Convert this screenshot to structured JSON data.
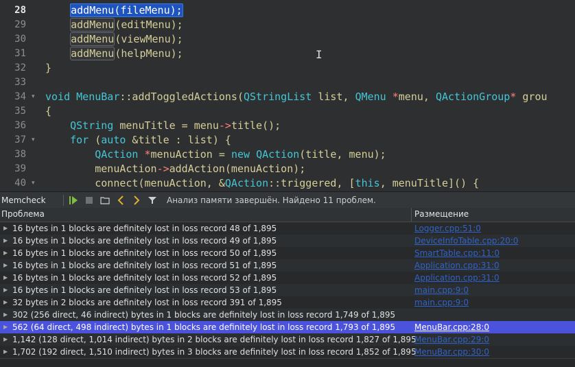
{
  "editor": {
    "lines": [
      {
        "num": "28",
        "current": true,
        "fold": "",
        "tokens": [
          [
            "",
            "    "
          ],
          [
            "sel",
            "addMenu(fileMenu);"
          ]
        ]
      },
      {
        "num": "29",
        "fold": "",
        "tokens": [
          [
            "",
            "    "
          ],
          [
            "hl",
            "addMenu"
          ],
          [
            "",
            "(editMenu);"
          ]
        ]
      },
      {
        "num": "30",
        "fold": "",
        "tokens": [
          [
            "",
            "    "
          ],
          [
            "hl",
            "addMenu"
          ],
          [
            "",
            "(viewMenu);"
          ]
        ]
      },
      {
        "num": "31",
        "fold": "",
        "tokens": [
          [
            "",
            "    "
          ],
          [
            "hl",
            "addMenu"
          ],
          [
            "",
            "(helpMenu);"
          ]
        ]
      },
      {
        "num": "32",
        "fold": "",
        "tokens": [
          [
            "",
            "}"
          ]
        ]
      },
      {
        "num": "33",
        "fold": "",
        "tokens": []
      },
      {
        "num": "34",
        "fold": "▾",
        "tokens": [
          [
            "kw",
            "void "
          ],
          [
            "ty",
            "MenuBar"
          ],
          [
            "",
            "::addToggledActions("
          ],
          [
            "ty",
            "QStringList"
          ],
          [
            "",
            " list, "
          ],
          [
            "ty",
            "QMenu"
          ],
          [
            "ar",
            " *"
          ],
          [
            "",
            "menu, "
          ],
          [
            "ty",
            "QActionGroup"
          ],
          [
            "ar",
            "*"
          ],
          [
            "",
            " grou"
          ]
        ]
      },
      {
        "num": "35",
        "fold": "",
        "tokens": [
          [
            "",
            "{"
          ]
        ]
      },
      {
        "num": "36",
        "fold": "",
        "tokens": [
          [
            "",
            "    "
          ],
          [
            "ty",
            "QString"
          ],
          [
            "",
            " menuTitle = menu"
          ],
          [
            "ar",
            "->"
          ],
          [
            "",
            "title();"
          ]
        ]
      },
      {
        "num": "37",
        "fold": "▾",
        "tokens": [
          [
            "",
            "    "
          ],
          [
            "kw",
            "for"
          ],
          [
            "",
            " ("
          ],
          [
            "kw",
            "auto"
          ],
          [
            "",
            " &title : list) {"
          ]
        ]
      },
      {
        "num": "38",
        "fold": "",
        "tokens": [
          [
            "",
            "        "
          ],
          [
            "ty",
            "QAction"
          ],
          [
            "ar",
            " *"
          ],
          [
            "",
            "menuAction = "
          ],
          [
            "kw",
            "new "
          ],
          [
            "ty",
            "QAction"
          ],
          [
            "",
            "(title, menu);"
          ]
        ]
      },
      {
        "num": "39",
        "fold": "",
        "tokens": [
          [
            "",
            "        menuAction"
          ],
          [
            "ar",
            "->"
          ],
          [
            "",
            "addAction(menuAction);"
          ]
        ]
      },
      {
        "num": "40",
        "fold": "▾",
        "tokens": [
          [
            "",
            "        connect(menuAction, &"
          ],
          [
            "ty",
            "QAction"
          ],
          [
            "",
            "::triggered, ["
          ],
          [
            "kw",
            "this"
          ],
          [
            "",
            ", menuTitle]() {"
          ]
        ]
      }
    ]
  },
  "toolbar": {
    "title": "Memcheck",
    "status": "Анализ памяти завершён. Найдено 11 проблем.",
    "icons": [
      "run-analysis-icon",
      "stop-icon",
      "open-icon",
      "previous-icon",
      "next-icon",
      "filter-icon"
    ]
  },
  "table": {
    "headers": {
      "problem": "Проблема",
      "location": "Размещение"
    },
    "rows": [
      {
        "desc": "16 bytes in 1 blocks are definitely lost in loss record 48 of 1,895",
        "loc": "Logger.cpp:51:0"
      },
      {
        "desc": "16 bytes in 1 blocks are definitely lost in loss record 49 of 1,895",
        "loc": "DeviceInfoTable.cpp:20:0"
      },
      {
        "desc": "16 bytes in 1 blocks are definitely lost in loss record 50 of 1,895",
        "loc": "SmartTable.cpp:11:0"
      },
      {
        "desc": "16 bytes in 1 blocks are definitely lost in loss record 51 of 1,895",
        "loc": "Application.cpp:31:0"
      },
      {
        "desc": "16 bytes in 1 blocks are definitely lost in loss record 52 of 1,895",
        "loc": "Application.cpp:31:0"
      },
      {
        "desc": "16 bytes in 1 blocks are definitely lost in loss record 53 of 1,895",
        "loc": "main.cpp:9:0"
      },
      {
        "desc": "32 bytes in 2 blocks are definitely lost in loss record 391 of 1,895",
        "loc": "main.cpp:9:0"
      },
      {
        "desc": "302 (256 direct, 46 indirect) bytes in 1 blocks are definitely lost in loss record 1,749 of 1,895",
        "loc": ""
      },
      {
        "desc": "562 (64 direct, 498 indirect) bytes in 1 blocks are definitely lost in loss record 1,793 of 1,895",
        "loc": "MenuBar.cpp:28:0",
        "selected": true
      },
      {
        "desc": "1,142 (128 direct, 1,014 indirect) bytes in 2 blocks are definitely lost in loss record 1,827 of 1,895",
        "loc": "MenuBar.cpp:29:0"
      },
      {
        "desc": "1,702 (192 direct, 1,510 indirect) bytes in 3 blocks are definitely lost in loss record 1,852 of 1,895",
        "loc": "MenuBar.cpp:30:0"
      }
    ]
  },
  "colors": {
    "selection": "#4b52dc",
    "link": "#2f63c7",
    "keyword": "#45c6d6",
    "text": "#d6cf9a"
  }
}
